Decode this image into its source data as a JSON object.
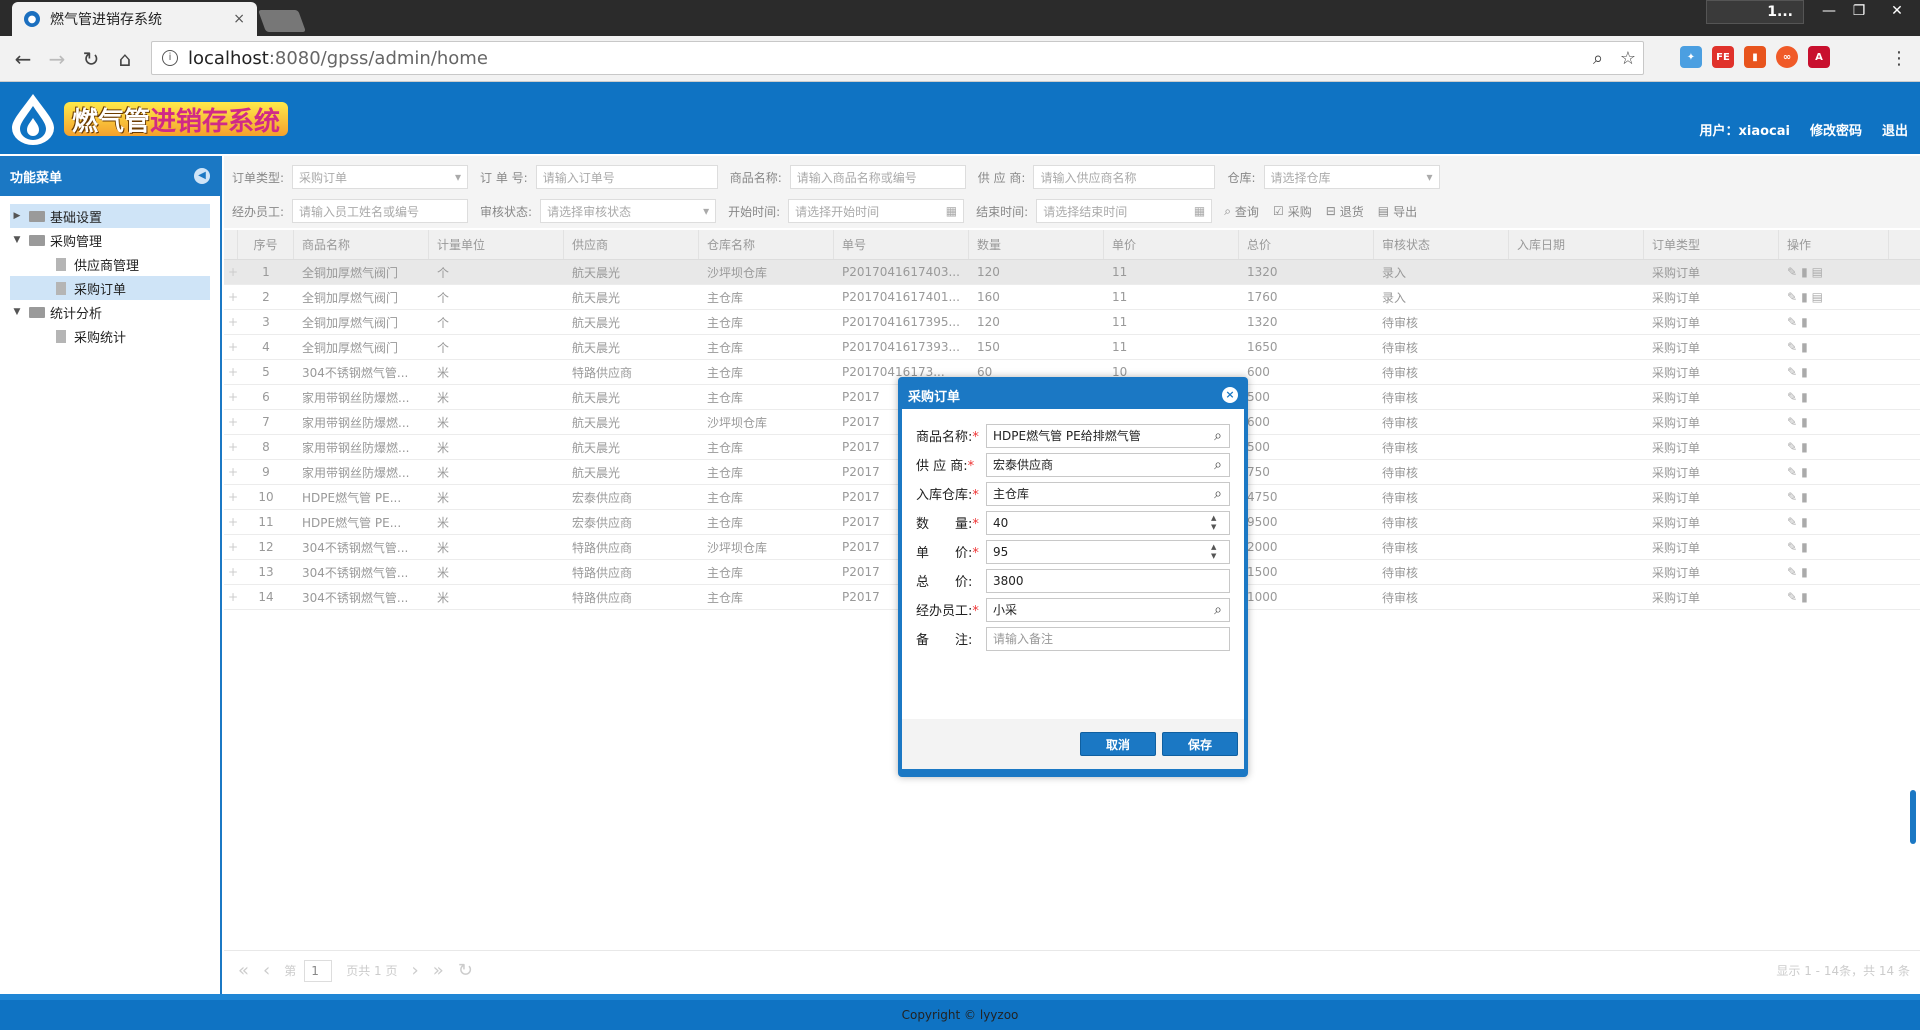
{
  "browser": {
    "tab_title": "燃气管进销存系统",
    "tab_close": "×",
    "user_badge": "1...",
    "url_host": "localhost",
    "url_rest": ":8080/gpss/admin/home"
  },
  "header": {
    "logo_text_a": "燃气管",
    "logo_text_b": "进销存系统",
    "user_label": "用户：xiaocai",
    "change_password": "修改密码",
    "logout": "退出"
  },
  "sidebar": {
    "title": "功能菜单",
    "items": [
      {
        "label": "基础设置"
      },
      {
        "label": "采购管理"
      },
      {
        "label": "供应商管理"
      },
      {
        "label": "采购订单"
      },
      {
        "label": "统计分析"
      },
      {
        "label": "采购统计"
      }
    ]
  },
  "filters": {
    "order_type_label": "订单类型:",
    "order_type_value": "采购订单",
    "order_no_label": "订 单 号:",
    "order_no_ph": "请输入订单号",
    "product_label": "商品名称:",
    "product_ph": "请输入商品名称或编号",
    "supplier_label": "供 应 商:",
    "supplier_ph": "请输入供应商名称",
    "warehouse_label": "仓库:",
    "warehouse_ph": "请选择仓库",
    "staff_label": "经办员工:",
    "staff_ph": "请输入员工姓名或编号",
    "audit_label": "审核状态:",
    "audit_ph": "请选择审核状态",
    "start_label": "开始时间:",
    "start_ph": "请选择开始时间",
    "end_label": "结束时间:",
    "end_ph": "请选择结束时间",
    "btn_query": "查询",
    "btn_purchase": "采购",
    "btn_return": "退货",
    "btn_export": "导出"
  },
  "grid": {
    "columns": [
      "序号",
      "商品名称",
      "计量单位",
      "供应商",
      "仓库名称",
      "单号",
      "数量",
      "单价",
      "总价",
      "审核状态",
      "入库日期",
      "订单类型",
      "操作"
    ],
    "rows": [
      {
        "no": "1",
        "name": "全铜加厚燃气阀门",
        "unit": "个",
        "supplier": "航天晨光",
        "wh": "沙坪坝仓库",
        "order": "P2017041617403...",
        "qty": "120",
        "price": "11",
        "total": "1320",
        "status": "录入",
        "date": "",
        "type": "采购订单"
      },
      {
        "no": "2",
        "name": "全铜加厚燃气阀门",
        "unit": "个",
        "supplier": "航天晨光",
        "wh": "主仓库",
        "order": "P2017041617401...",
        "qty": "160",
        "price": "11",
        "total": "1760",
        "status": "录入",
        "date": "",
        "type": "采购订单"
      },
      {
        "no": "3",
        "name": "全铜加厚燃气阀门",
        "unit": "个",
        "supplier": "航天晨光",
        "wh": "主仓库",
        "order": "P2017041617395...",
        "qty": "120",
        "price": "11",
        "total": "1320",
        "status": "待审核",
        "date": "",
        "type": "采购订单"
      },
      {
        "no": "4",
        "name": "全铜加厚燃气阀门",
        "unit": "个",
        "supplier": "航天晨光",
        "wh": "主仓库",
        "order": "P2017041617393...",
        "qty": "150",
        "price": "11",
        "total": "1650",
        "status": "待审核",
        "date": "",
        "type": "采购订单"
      },
      {
        "no": "5",
        "name": "304不锈钢燃气管...",
        "unit": "米",
        "supplier": "特路供应商",
        "wh": "主仓库",
        "order": "P20170416173...",
        "qty": "60",
        "price": "10",
        "total": "600",
        "status": "待审核",
        "date": "",
        "type": "采购订单"
      },
      {
        "no": "6",
        "name": "家用带钢丝防爆燃...",
        "unit": "米",
        "supplier": "航天晨光",
        "wh": "主仓库",
        "order": "P2017",
        "qty": "",
        "price": "",
        "total": "500",
        "status": "待审核",
        "date": "",
        "type": "采购订单"
      },
      {
        "no": "7",
        "name": "家用带钢丝防爆燃...",
        "unit": "米",
        "supplier": "航天晨光",
        "wh": "沙坪坝仓库",
        "order": "P2017",
        "qty": "",
        "price": "",
        "total": "600",
        "status": "待审核",
        "date": "",
        "type": "采购订单"
      },
      {
        "no": "8",
        "name": "家用带钢丝防爆燃...",
        "unit": "米",
        "supplier": "航天晨光",
        "wh": "主仓库",
        "order": "P2017",
        "qty": "",
        "price": "",
        "total": "500",
        "status": "待审核",
        "date": "",
        "type": "采购订单"
      },
      {
        "no": "9",
        "name": "家用带钢丝防爆燃...",
        "unit": "米",
        "supplier": "航天晨光",
        "wh": "主仓库",
        "order": "P2017",
        "qty": "",
        "price": "",
        "total": "750",
        "status": "待审核",
        "date": "",
        "type": "采购订单"
      },
      {
        "no": "10",
        "name": "HDPE燃气管 PE...",
        "unit": "米",
        "supplier": "宏泰供应商",
        "wh": "主仓库",
        "order": "P2017",
        "qty": "",
        "price": "",
        "total": "4750",
        "status": "待审核",
        "date": "",
        "type": "采购订单"
      },
      {
        "no": "11",
        "name": "HDPE燃气管 PE...",
        "unit": "米",
        "supplier": "宏泰供应商",
        "wh": "主仓库",
        "order": "P2017",
        "qty": "",
        "price": "",
        "total": "9500",
        "status": "待审核",
        "date": "",
        "type": "采购订单"
      },
      {
        "no": "12",
        "name": "304不锈钢燃气管...",
        "unit": "米",
        "supplier": "特路供应商",
        "wh": "沙坪坝仓库",
        "order": "P2017",
        "qty": "",
        "price": "",
        "total": "2000",
        "status": "待审核",
        "date": "",
        "type": "采购订单"
      },
      {
        "no": "13",
        "name": "304不锈钢燃气管...",
        "unit": "米",
        "supplier": "特路供应商",
        "wh": "主仓库",
        "order": "P2017",
        "qty": "",
        "price": "",
        "total": "1500",
        "status": "待审核",
        "date": "",
        "type": "采购订单"
      },
      {
        "no": "14",
        "name": "304不锈钢燃气管...",
        "unit": "米",
        "supplier": "特路供应商",
        "wh": "主仓库",
        "order": "P2017",
        "qty": "",
        "price": "",
        "total": "1000",
        "status": "待审核",
        "date": "",
        "type": "采购订单"
      }
    ]
  },
  "pager": {
    "page_label": "第",
    "page_value": "1",
    "total_pages": "页共 1 页",
    "info": "显示 1 - 14条，共 14 条"
  },
  "footer": {
    "copyright": "Copyright © lyyzoo"
  },
  "modal": {
    "title": "采购订单",
    "fields": [
      {
        "label": "商品名称:",
        "required": true,
        "value": "HDPE燃气管 PE给排燃气管"
      },
      {
        "label": "供 应 商:",
        "required": true,
        "value": "宏泰供应商"
      },
      {
        "label": "入库仓库:",
        "required": true,
        "value": "主仓库"
      },
      {
        "label": "数　　量:",
        "required": true,
        "value": "40"
      },
      {
        "label": "单　　价:",
        "required": true,
        "value": "95"
      },
      {
        "label": "总　　价:",
        "required": false,
        "value": "3800"
      },
      {
        "label": "经办员工:",
        "required": true,
        "value": "小采"
      },
      {
        "label": "备　　注:",
        "required": false,
        "value": "",
        "placeholder": "请输入备注"
      }
    ],
    "cancel": "取消",
    "save": "保存"
  }
}
